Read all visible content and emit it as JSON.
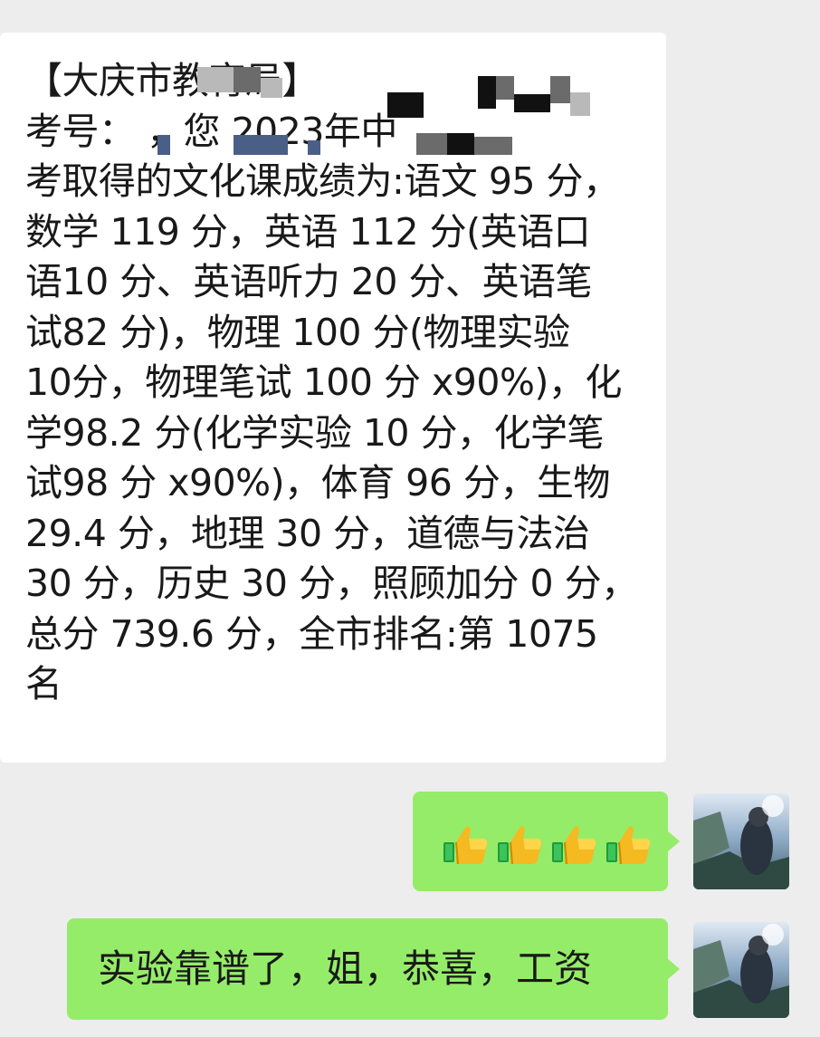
{
  "chat": {
    "incoming_message": {
      "lines": [
        "【大庆市教育局】",
        "考号：          ，您         2023年中",
        "考取得的文化课成绩为:语文 95 分，",
        "数学 119 分，英语 112 分(英语口",
        "语10 分、英语听力 20 分、英语笔",
        "试82 分)，物理 100 分(物理实验",
        "10分，物理笔试 100 分 x90%)，化",
        "学98.2 分(化学实验 10 分，化学笔",
        "试98 分 x90%)，体育 96 分，生物",
        "29.4 分，地理 30 分，道德与法治",
        "30 分，历史 30 分，照顾加分 0 分，",
        "总分 739.6 分，全市排名:第 1075",
        "名"
      ]
    },
    "outgoing_messages": [
      {
        "type": "emoji",
        "emoji": [
          "thumbs-up",
          "thumbs-up",
          "thumbs-up",
          "thumbs-up"
        ]
      },
      {
        "type": "text",
        "text": "实验靠谱了，姐，恭喜，工资"
      }
    ]
  },
  "colors": {
    "background": "#ededed",
    "incoming_bubble": "#ffffff",
    "outgoing_bubble": "#95ec69",
    "text": "#191919"
  }
}
